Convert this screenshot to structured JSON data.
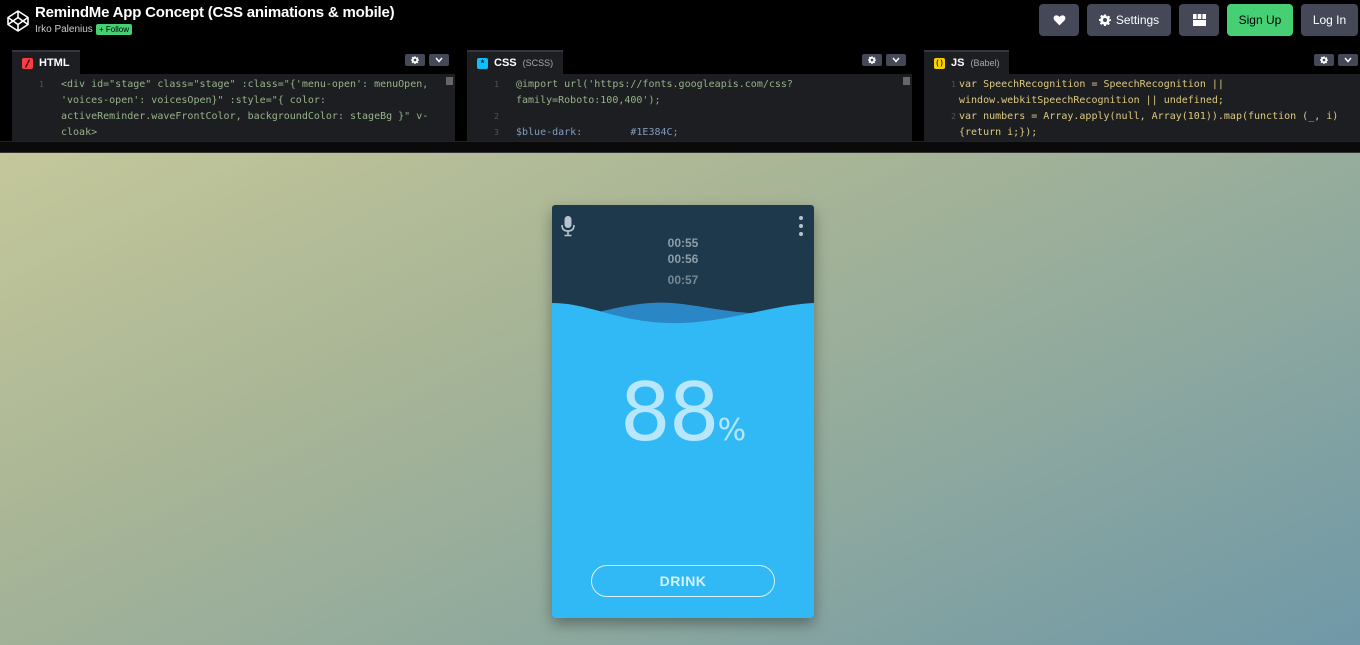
{
  "header": {
    "title": "RemindMe App Concept (CSS animations & mobile)",
    "author": "Irko Palenius",
    "follow_label": "+ Follow",
    "buttons": {
      "heart_icon": "heart-icon",
      "settings_label": "Settings",
      "layout_icon": "layout-icon",
      "signup_label": "Sign Up",
      "login_label": "Log In"
    }
  },
  "editors": [
    {
      "name": "HTML",
      "sub": "",
      "icon_color": "#ff3c41",
      "line_numbers": [
        "1",
        "",
        "",
        ""
      ],
      "lines": [
        "<div id=\"stage\" class=\"stage\" :class=\"{'menu-open': menuOpen,",
        "'voices-open': voicesOpen}\" :style=\"{ color:",
        "activeReminder.waveFrontColor, backgroundColor: stageBg }\" v-",
        "cloak>"
      ]
    },
    {
      "name": "CSS",
      "sub": "(SCSS)",
      "icon_color": "#0ebeff",
      "line_numbers": [
        "1",
        "",
        "2",
        "3"
      ],
      "lines": [
        "@import url('https://fonts.googleapis.com/css?",
        "family=Roboto:100,400');",
        "",
        "$blue-dark:        #1E384C;"
      ]
    },
    {
      "name": "JS",
      "sub": "(Babel)",
      "icon_color": "#fcd000",
      "line_numbers": [
        "1",
        "",
        "2",
        ""
      ],
      "lines": [
        "var SpeechRecognition = SpeechRecognition ||",
        "window.webkitSpeechRecognition || undefined;",
        "var numbers = Array.apply(null, Array(101)).map(function (_, i)",
        "{return i;});"
      ]
    }
  ],
  "app": {
    "times": [
      "00:55",
      "00:56",
      "00:57"
    ],
    "percent_value": "88",
    "percent_sign": "%",
    "drink_label": "DRINK",
    "colors": {
      "dark_bg": "#1E384C",
      "water": "#31b9f6",
      "wave_back": "#2a86c4"
    }
  }
}
